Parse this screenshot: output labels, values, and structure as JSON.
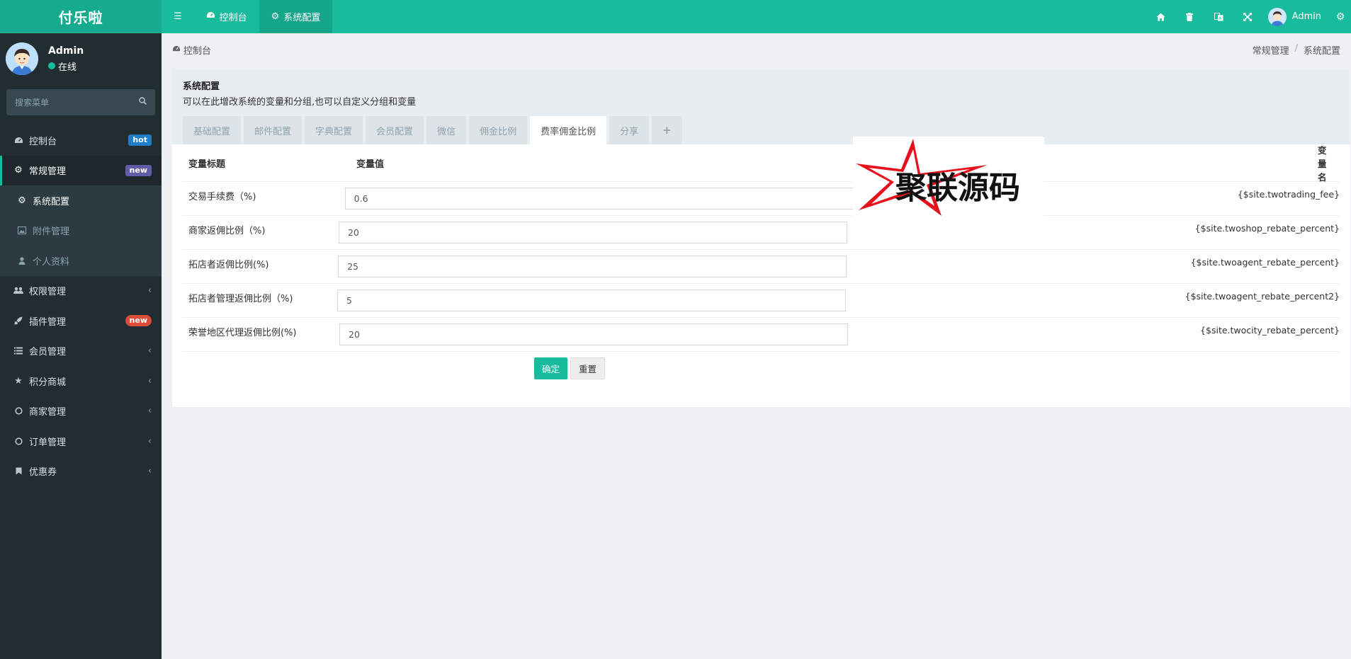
{
  "app": {
    "logo": "付乐啦"
  },
  "topbar": {
    "tabs": [
      {
        "label": "控制台"
      },
      {
        "label": "系统配置"
      }
    ],
    "user": "Admin"
  },
  "sidebar": {
    "user": {
      "name": "Admin",
      "status": "在线"
    },
    "search_placeholder": "搜索菜单",
    "items": [
      {
        "label": "控制台",
        "badge": "hot"
      },
      {
        "label": "常规管理",
        "badge": "new"
      },
      {
        "label": "系统配置"
      },
      {
        "label": "附件管理"
      },
      {
        "label": "个人资料"
      },
      {
        "label": "权限管理"
      },
      {
        "label": "插件管理",
        "badge": "new"
      },
      {
        "label": "会员管理"
      },
      {
        "label": "积分商城"
      },
      {
        "label": "商家管理"
      },
      {
        "label": "订单管理"
      },
      {
        "label": "优惠券"
      }
    ]
  },
  "breadcrumb": {
    "left": "控制台",
    "right": [
      "常规管理",
      "系统配置"
    ]
  },
  "panel": {
    "title": "系统配置",
    "description": "可以在此增改系统的变量和分组,也可以自定义分组和变量",
    "tabs": [
      "基础配置",
      "邮件配置",
      "字典配置",
      "会员配置",
      "微信",
      "佣金比例",
      "费率佣金比例",
      "分享",
      "+"
    ],
    "active_tab": "费率佣金比例"
  },
  "table": {
    "headers": [
      "变量标题",
      "变量值",
      "变量名"
    ],
    "rows": [
      {
        "title": "交易手续费（%)",
        "value": "0.6",
        "name": "{$site.twotrading_fee}"
      },
      {
        "title": "商家返佣比例（%)",
        "value": "20",
        "name": "{$site.twoshop_rebate_percent}"
      },
      {
        "title": "拓店者返佣比例(%)",
        "value": "25",
        "name": "{$site.twoagent_rebate_percent}"
      },
      {
        "title": "拓店者管理返佣比例（%)",
        "value": "5",
        "name": "{$site.twoagent_rebate_percent2}"
      },
      {
        "title": "荣誉地区代理返佣比例(%)",
        "value": "20",
        "name": "{$site.twocity_rebate_percent}"
      }
    ]
  },
  "buttons": {
    "submit": "确定",
    "reset": "重置"
  },
  "watermark": {
    "text": "聚联源码"
  },
  "colors": {
    "brand": "#18bc9c",
    "sidebar": "#222d32",
    "badge_hot": "#1f7ec7",
    "badge_new": "#605ca8",
    "badge_new_red": "#dd4b39"
  }
}
